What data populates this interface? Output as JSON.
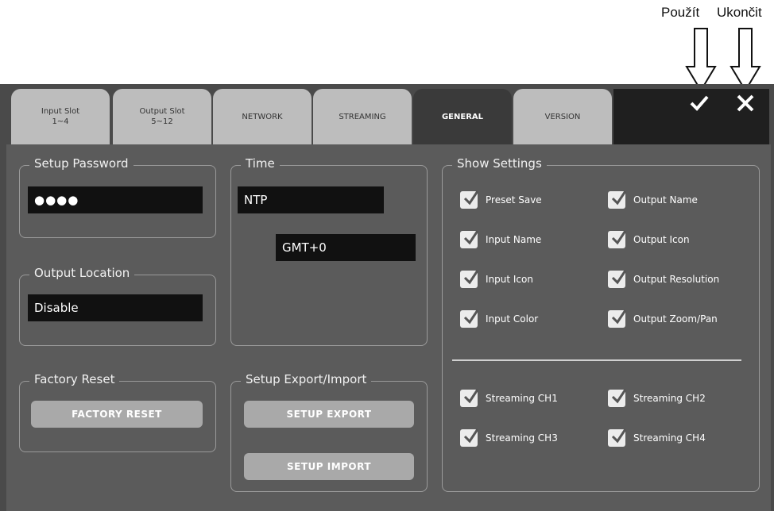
{
  "callouts": {
    "apply": "Použít",
    "exit": "Ukončit"
  },
  "tabs": [
    {
      "line1": "Input Slot",
      "line2": "1~4"
    },
    {
      "line1": "Output Slot",
      "line2": "5~12"
    },
    {
      "line1": "NETWORK",
      "line2": ""
    },
    {
      "line1": "STREAMING",
      "line2": ""
    },
    {
      "line1": "GENERAL",
      "line2": ""
    },
    {
      "line1": "VERSION",
      "line2": ""
    }
  ],
  "header_icons": {
    "apply": "check-icon",
    "close": "close-icon"
  },
  "setup_password": {
    "legend": "Setup Password",
    "value": "●●●●"
  },
  "output_location": {
    "legend": "Output Location",
    "value": "Disable"
  },
  "factory_reset": {
    "legend": "Factory Reset",
    "button": "FACTORY RESET"
  },
  "time": {
    "legend": "Time",
    "mode": "NTP",
    "timezone": "GMT+0"
  },
  "setup_export_import": {
    "legend": "Setup Export/Import",
    "export": "SETUP EXPORT",
    "import": "SETUP IMPORT"
  },
  "show_settings": {
    "legend": "Show Settings",
    "items": [
      {
        "label": "Preset Save",
        "checked": true
      },
      {
        "label": "Output Name",
        "checked": true
      },
      {
        "label": "Input Name",
        "checked": true
      },
      {
        "label": "Output Icon",
        "checked": true
      },
      {
        "label": "Input Icon",
        "checked": true
      },
      {
        "label": "Output Resolution",
        "checked": true
      },
      {
        "label": "Input Color",
        "checked": true
      },
      {
        "label": "Output Zoom/Pan",
        "checked": true
      },
      {
        "label": "Streaming CH1",
        "checked": true
      },
      {
        "label": "Streaming CH2",
        "checked": true
      },
      {
        "label": "Streaming CH3",
        "checked": true
      },
      {
        "label": "Streaming CH4",
        "checked": true
      }
    ]
  }
}
